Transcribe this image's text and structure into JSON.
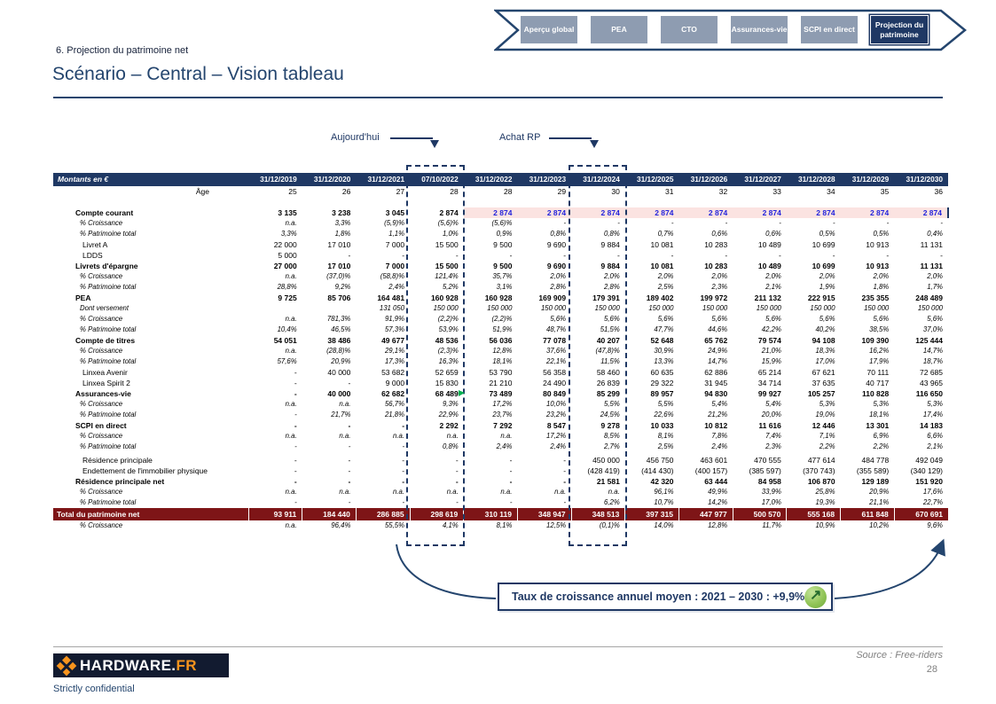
{
  "header": {
    "slide_label": "6. Projection du patrimoine net",
    "title": "Scénario – Central – Vision tableau"
  },
  "nav": {
    "tabs": [
      {
        "label": "Aperçu global",
        "selected": false
      },
      {
        "label": "PEA",
        "selected": false
      },
      {
        "label": "CTO",
        "selected": false
      },
      {
        "label": "Assurances-vie",
        "selected": false
      },
      {
        "label": "SCPI en direct",
        "selected": false
      },
      {
        "label": "Projection du patrimoine",
        "selected": true
      }
    ]
  },
  "callouts": {
    "today": "Aujourd'hui",
    "purchase": "Achat RP"
  },
  "table": {
    "corner_label": "Montants en €",
    "columns": [
      "31/12/2019",
      "31/12/2020",
      "31/12/2021",
      "07/10/2022",
      "31/12/2022",
      "31/12/2023",
      "31/12/2024",
      "31/12/2025",
      "31/12/2026",
      "31/12/2027",
      "31/12/2028",
      "31/12/2029",
      "31/12/2030"
    ],
    "age_label": "Âge",
    "ages": [
      "25",
      "26",
      "27",
      "28",
      "28",
      "29",
      "30",
      "31",
      "32",
      "33",
      "34",
      "35",
      "36"
    ],
    "rows": [
      {
        "label": "Compte courant",
        "style": "section",
        "highlight_from": 4,
        "values": [
          "3 135",
          "3 238",
          "3 045",
          "2 874",
          "2 874",
          "2 874",
          "2 874",
          "2 874",
          "2 874",
          "2 874",
          "2 874",
          "2 874",
          "2 874"
        ]
      },
      {
        "label": "% Croissance",
        "style": "pct",
        "values": [
          "n.a.",
          "3,3%",
          "(5,9)%",
          "(5,6)%",
          "(5,6)%",
          "-",
          "-",
          "-",
          "-",
          "-",
          "-",
          "-",
          "-"
        ]
      },
      {
        "label": "% Patrimoine total",
        "style": "pct",
        "values": [
          "3,3%",
          "1,8%",
          "1,1%",
          "1,0%",
          "0,9%",
          "0,8%",
          "0,8%",
          "0,7%",
          "0,6%",
          "0,6%",
          "0,5%",
          "0,5%",
          "0,4%"
        ]
      },
      {
        "label": "Livret A",
        "style": "plain",
        "values": [
          "22 000",
          "17 010",
          "7 000",
          "15 500",
          "9 500",
          "9 690",
          "9 884",
          "10 081",
          "10 283",
          "10 489",
          "10 699",
          "10 913",
          "11 131"
        ]
      },
      {
        "label": "LDDS",
        "style": "plain",
        "values": [
          "5 000",
          "-",
          "-",
          "-",
          "-",
          "-",
          "-",
          "-",
          "-",
          "-",
          "-",
          "-",
          "-"
        ]
      },
      {
        "label": "Livrets d'épargne",
        "style": "section",
        "values": [
          "27 000",
          "17 010",
          "7 000",
          "15 500",
          "9 500",
          "9 690",
          "9 884",
          "10 081",
          "10 283",
          "10 489",
          "10 699",
          "10 913",
          "11 131"
        ]
      },
      {
        "label": "% Croissance",
        "style": "pct",
        "values": [
          "n.a.",
          "(37,0)%",
          "(58,8)%",
          "121,4%",
          "35,7%",
          "2,0%",
          "2,0%",
          "2,0%",
          "2,0%",
          "2,0%",
          "2,0%",
          "2,0%",
          "2,0%"
        ]
      },
      {
        "label": "% Patrimoine total",
        "style": "pct",
        "values": [
          "28,8%",
          "9,2%",
          "2,4%",
          "5,2%",
          "3,1%",
          "2,8%",
          "2,8%",
          "2,5%",
          "2,3%",
          "2,1%",
          "1,9%",
          "1,8%",
          "1,7%"
        ]
      },
      {
        "label": "PEA",
        "style": "section",
        "values": [
          "9 725",
          "85 706",
          "164 481",
          "160 928",
          "160 928",
          "169 909",
          "179 391",
          "189 402",
          "199 972",
          "211 132",
          "222 915",
          "235 355",
          "248 489"
        ]
      },
      {
        "label": "Dont versement",
        "style": "pct",
        "values": [
          "",
          "",
          "131 050",
          "150 000",
          "150 000",
          "150 000",
          "150 000",
          "150 000",
          "150 000",
          "150 000",
          "150 000",
          "150 000",
          "150 000"
        ]
      },
      {
        "label": "% Croissance",
        "style": "pct",
        "values": [
          "n.a.",
          "781,3%",
          "91,9%",
          "(2,2)%",
          "(2,2)%",
          "5,6%",
          "5,6%",
          "5,6%",
          "5,6%",
          "5,6%",
          "5,6%",
          "5,6%",
          "5,6%"
        ]
      },
      {
        "label": "% Patrimoine total",
        "style": "pct",
        "values": [
          "10,4%",
          "46,5%",
          "57,3%",
          "53,9%",
          "51,9%",
          "48,7%",
          "51,5%",
          "47,7%",
          "44,6%",
          "42,2%",
          "40,2%",
          "38,5%",
          "37,0%"
        ]
      },
      {
        "label": "Compte de titres",
        "style": "section",
        "values": [
          "54 051",
          "38 486",
          "49 677",
          "48 536",
          "56 036",
          "77 078",
          "40 207",
          "52 648",
          "65 762",
          "79 574",
          "94 108",
          "109 390",
          "125 444"
        ]
      },
      {
        "label": "% Croissance",
        "style": "pct",
        "values": [
          "n.a.",
          "(28,8)%",
          "29,1%",
          "(2,3)%",
          "12,8%",
          "37,6%",
          "(47,8)%",
          "30,9%",
          "24,9%",
          "21,0%",
          "18,3%",
          "16,2%",
          "14,7%"
        ]
      },
      {
        "label": "% Patrimoine total",
        "style": "pct",
        "values": [
          "57,6%",
          "20,9%",
          "17,3%",
          "16,3%",
          "18,1%",
          "22,1%",
          "11,5%",
          "13,3%",
          "14,7%",
          "15,9%",
          "17,0%",
          "17,9%",
          "18,7%"
        ]
      },
      {
        "label": "Linxea Avenir",
        "style": "plain",
        "values": [
          "-",
          "40 000",
          "53 682",
          "52 659",
          "53 790",
          "56 358",
          "58 460",
          "60 635",
          "62 886",
          "65 214",
          "67 621",
          "70 111",
          "72 685"
        ]
      },
      {
        "label": "Linxea Spirit 2",
        "style": "plain",
        "values": [
          "-",
          "-",
          "9 000",
          "15 830",
          "21 210",
          "24 490",
          "26 839",
          "29 322",
          "31 945",
          "34 714",
          "37 635",
          "40 717",
          "43 965"
        ]
      },
      {
        "label": "Assurances-vie",
        "style": "section",
        "values": [
          "-",
          "40 000",
          "62 682",
          "68 489",
          "73 489",
          "80 849",
          "85 299",
          "89 957",
          "94 830",
          "99 927",
          "105 257",
          "110 828",
          "116 650"
        ]
      },
      {
        "label": "% Croissance",
        "style": "pct",
        "values": [
          "n.a.",
          "n.a.",
          "56,7%",
          "9,3%",
          "17,2%",
          "10,0%",
          "5,5%",
          "5,5%",
          "5,4%",
          "5,4%",
          "5,3%",
          "5,3%",
          "5,3%"
        ]
      },
      {
        "label": "% Patrimoine total",
        "style": "pct",
        "values": [
          "-",
          "21,7%",
          "21,8%",
          "22,9%",
          "23,7%",
          "23,2%",
          "24,5%",
          "22,6%",
          "21,2%",
          "20,0%",
          "19,0%",
          "18,1%",
          "17,4%"
        ]
      },
      {
        "label": "SCPI en direct",
        "style": "section",
        "values": [
          "-",
          "-",
          "-",
          "2 292",
          "7 292",
          "8 547",
          "9 278",
          "10 033",
          "10 812",
          "11 616",
          "12 446",
          "13 301",
          "14 183"
        ]
      },
      {
        "label": "% Croissance",
        "style": "pct",
        "values": [
          "n.a.",
          "n.a.",
          "n.a.",
          "n.a.",
          "n.a.",
          "17,2%",
          "8,5%",
          "8,1%",
          "7,8%",
          "7,4%",
          "7,1%",
          "6,9%",
          "6,6%"
        ]
      },
      {
        "label": "% Patrimoine total",
        "style": "pct",
        "values": [
          "-",
          "-",
          "-",
          "0,8%",
          "2,4%",
          "2,4%",
          "2,7%",
          "2,5%",
          "2,4%",
          "2,3%",
          "2,2%",
          "2,2%",
          "2,1%"
        ]
      },
      {
        "label": "Résidence principale",
        "style": "plain",
        "gap_before": true,
        "values": [
          "-",
          "-",
          "-",
          "-",
          "-",
          "-",
          "450 000",
          "456 750",
          "463 601",
          "470 555",
          "477 614",
          "484 778",
          "492 049"
        ]
      },
      {
        "label": "Endettement de l'immobilier physique",
        "style": "plain",
        "values": [
          "-",
          "-",
          "-",
          "-",
          "-",
          "-",
          "(428 419)",
          "(414 430)",
          "(400 157)",
          "(385 597)",
          "(370 743)",
          "(355 589)",
          "(340 129)"
        ]
      },
      {
        "label": "Résidence principale net",
        "style": "section",
        "values": [
          "-",
          "-",
          "-",
          "-",
          "-",
          "-",
          "21 581",
          "42 320",
          "63 444",
          "84 958",
          "106 870",
          "129 189",
          "151 920"
        ]
      },
      {
        "label": "% Croissance",
        "style": "pct",
        "values": [
          "n.a.",
          "n.a.",
          "n.a.",
          "n.a.",
          "n.a.",
          "n.a.",
          "n.a.",
          "96,1%",
          "49,9%",
          "33,9%",
          "25,8%",
          "20,9%",
          "17,6%"
        ]
      },
      {
        "label": "% Patrimoine total",
        "style": "pct",
        "values": [
          "-",
          "-",
          "-",
          "-",
          "-",
          "-",
          "6,2%",
          "10,7%",
          "14,2%",
          "17,0%",
          "19,3%",
          "21,1%",
          "22,7%"
        ]
      },
      {
        "label": "Total du patrimoine net",
        "style": "total",
        "values": [
          "93 911",
          "184 440",
          "286 885",
          "298 619",
          "310 119",
          "348 947",
          "348 513",
          "397 315",
          "447 977",
          "500 570",
          "555 168",
          "611 848",
          "670 691"
        ]
      },
      {
        "label": "% Croissance",
        "style": "pct",
        "values": [
          "n.a.",
          "96,4%",
          "55,5%",
          "4,1%",
          "8,1%",
          "12,5%",
          "(0,1)%",
          "14,0%",
          "12,8%",
          "11,7%",
          "10,9%",
          "10,2%",
          "9,6%"
        ]
      }
    ]
  },
  "growth_note": {
    "text": "Taux de croissance annuel moyen : 2021 – 2030 : +9,9%",
    "icon": "trend-up-arrow"
  },
  "footer": {
    "logo_text": "HARDWARE.",
    "logo_suffix": "FR",
    "confidential": "Strictly confidential",
    "source": "Source : Free-riders",
    "page": "28"
  },
  "colors": {
    "accent_navy": "#1F3864",
    "table_header": "#1F3864",
    "total_row_maroon": "#7E1517",
    "highlight_pink": "#FBE3E1",
    "highlight_blue": "#2323DC",
    "tab_gray": "#8E9CB1",
    "logo_orange": "#F7941D",
    "growth_icon_green": "#92C558",
    "comment_marker_green": "#00B050"
  }
}
